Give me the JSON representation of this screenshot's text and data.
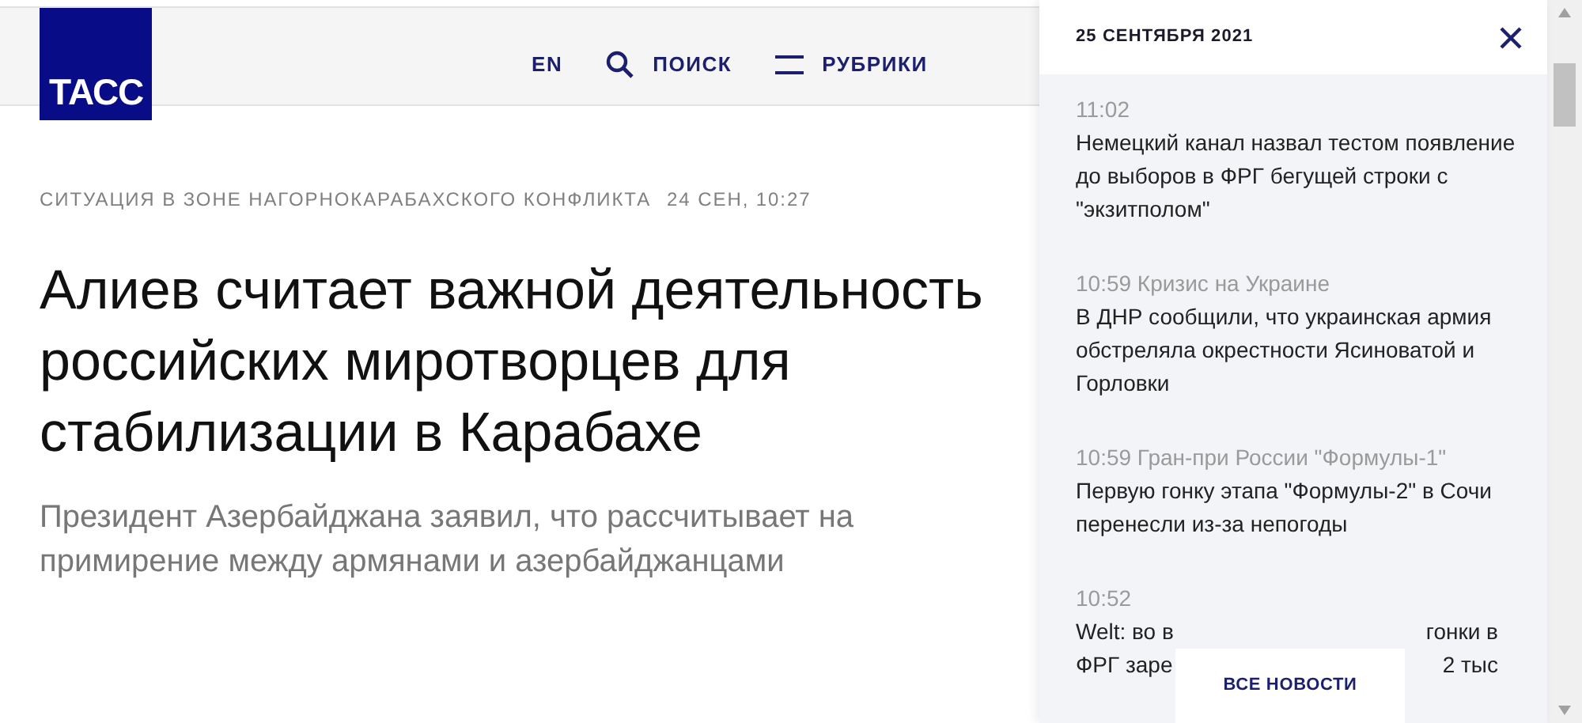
{
  "header": {
    "logo": "ТАСС",
    "nav": [
      {
        "kind": "lang",
        "label": "EN"
      },
      {
        "kind": "search",
        "label": "ПОИСК"
      },
      {
        "kind": "menu",
        "label": "РУБРИКИ"
      }
    ]
  },
  "article": {
    "rubric": "СИТУАЦИЯ В ЗОНЕ НАГОРНОКАРАБАХСКОГО КОНФЛИКТА",
    "date": "24 СЕН, 10:27",
    "title": "Алиев считает важной деятельность российских миротворцев для стабилизации в Карабахе",
    "lead": "Президент Азербайджана заявил, что рассчитывает на примирение между армянами и азербайджанцами"
  },
  "news_panel": {
    "date": "25 СЕНТЯБРЯ 2021",
    "items": [
      {
        "kind": "full",
        "time": "11:02",
        "title": "Немецкий канал назвал тестом появление до выборов в ФРГ бегущей строки с \"экзитполом\""
      },
      {
        "kind": "full",
        "time": "10:59 Кризис на Украине",
        "title": "В ДНР сообщили, что украинская армия обстреляла окрестности Ясиноватой и Горловки"
      },
      {
        "kind": "full",
        "time": "10:59 Гран-при России \"Формулы-1\"",
        "title": "Первую гонку этапа \"Формулы-2\" в Сочи перенесли из-за непогоды"
      },
      {
        "kind": "covered",
        "time": "10:52",
        "lines": [
          {
            "left": "Welt: во в",
            "right": "гонки в"
          },
          {
            "left": "ФРГ заре",
            "right": "2 тыс"
          }
        ]
      }
    ],
    "all_news_button": "ВСЕ НОВОСТИ"
  }
}
